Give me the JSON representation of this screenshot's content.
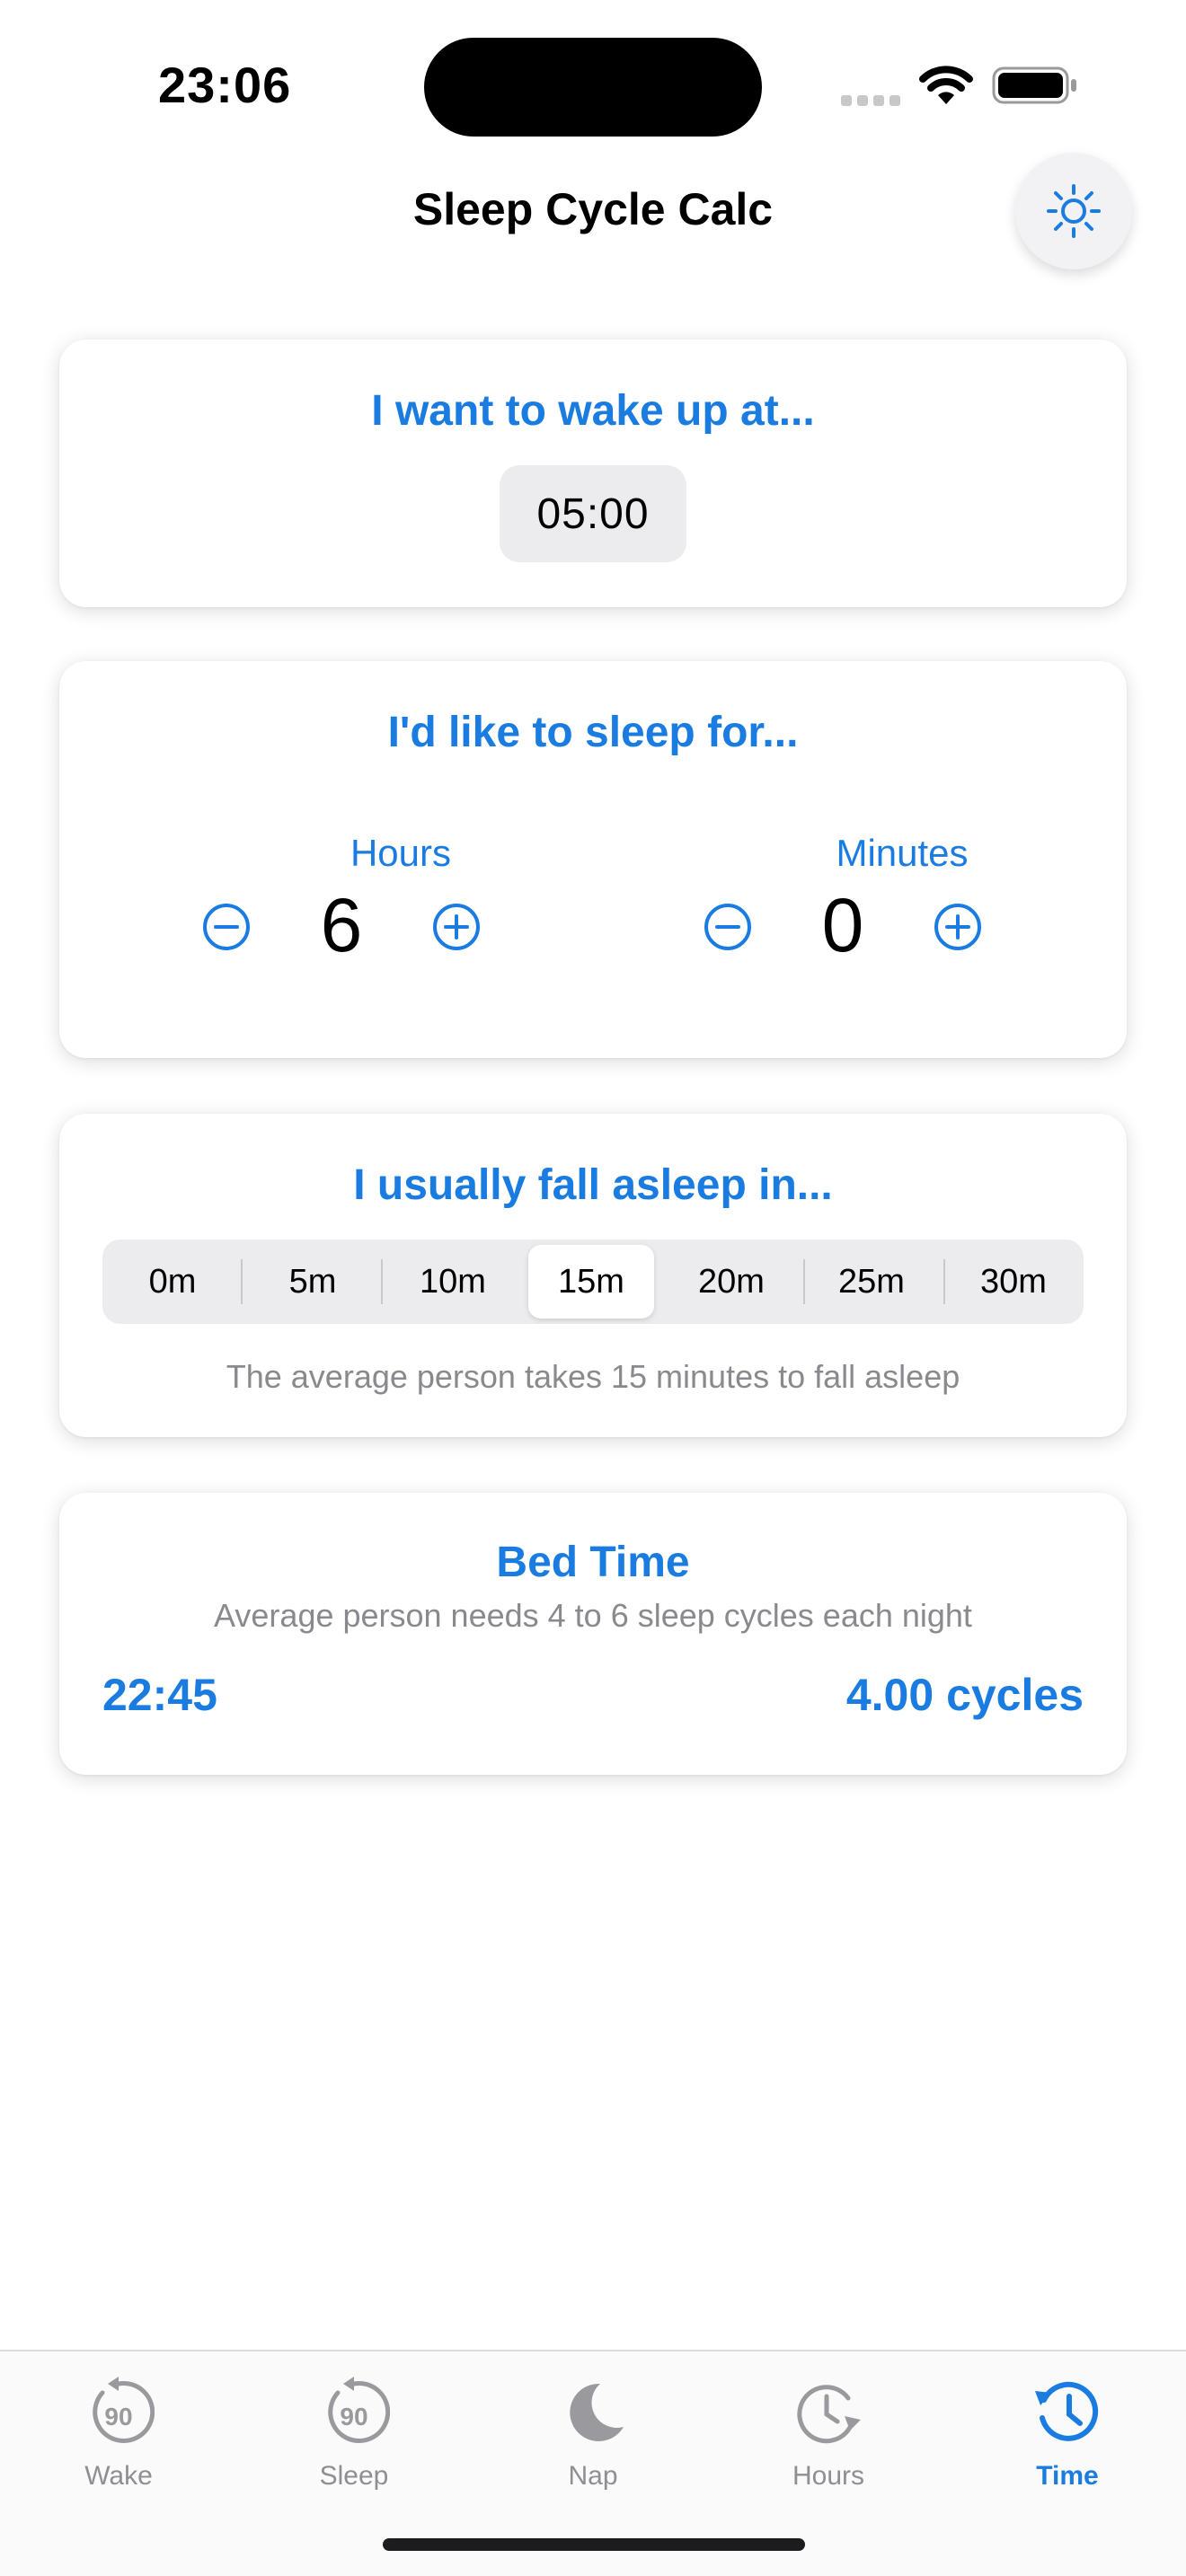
{
  "status_bar": {
    "time": "23:06"
  },
  "header": {
    "title": "Sleep Cycle Calc",
    "theme_icon": "sun-icon"
  },
  "wake_card": {
    "title": "I want to wake up at...",
    "time": "05:00"
  },
  "duration_card": {
    "title": "I'd like to sleep for...",
    "hours_label": "Hours",
    "hours_value": "6",
    "minutes_label": "Minutes",
    "minutes_value": "0"
  },
  "fall_asleep_card": {
    "title": "I usually fall asleep in...",
    "options": [
      "0m",
      "5m",
      "10m",
      "15m",
      "20m",
      "25m",
      "30m"
    ],
    "selected": "15m",
    "hint": "The average person takes 15 minutes to fall asleep"
  },
  "result_card": {
    "title": "Bed Time",
    "subtitle": "Average person needs 4 to 6 sleep cycles each night",
    "bed_time": "22:45",
    "cycles": "4.00 cycles"
  },
  "tabs": [
    {
      "label": "Wake",
      "icon": "wake-90-icon",
      "active": false
    },
    {
      "label": "Sleep",
      "icon": "sleep-90-icon",
      "active": false
    },
    {
      "label": "Nap",
      "icon": "moon-icon",
      "active": false
    },
    {
      "label": "Hours",
      "icon": "clock-forward-icon",
      "active": false
    },
    {
      "label": "Time",
      "icon": "clock-history-icon",
      "active": true
    }
  ],
  "colors": {
    "accent": "#1a7ce0",
    "inactive": "#8e8e93",
    "hint": "#8a8a8e"
  }
}
